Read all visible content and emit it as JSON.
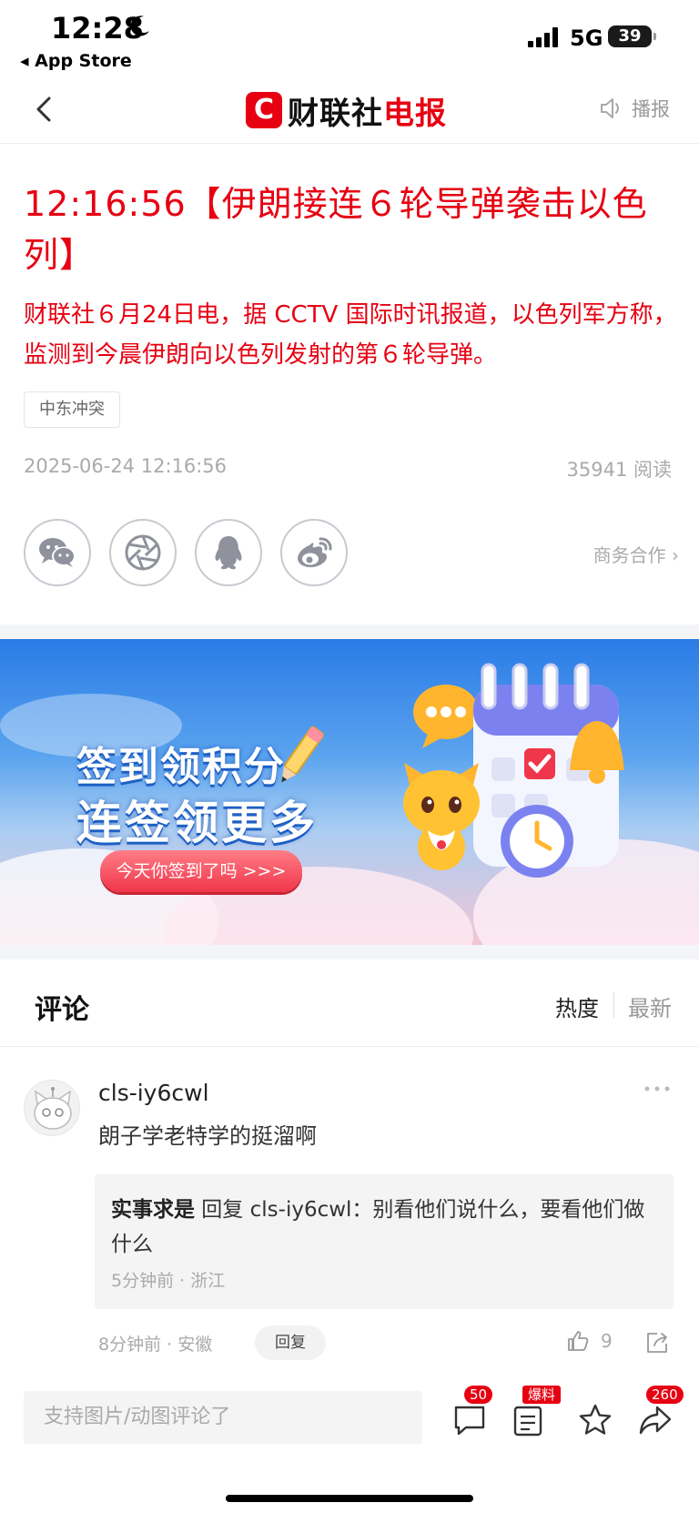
{
  "status_bar": {
    "time": "12:28",
    "back_app": "◂ App Store",
    "network": "5G",
    "battery": "39"
  },
  "nav": {
    "brand_c": "C",
    "brand_black": "财联社",
    "brand_red": "电报",
    "broadcast_label": "播报"
  },
  "article": {
    "headline": "12:16:56【伊朗接连６轮导弹袭击以色列】",
    "summary": "财联社６月24日电，据 CCTV 国际时讯报道，以色列军方称，监测到今晨伊朗向以色列发射的第６轮导弹。",
    "tag": "中东冲突",
    "date": "2025-06-24 12:16:56",
    "reads": "35941 阅读",
    "business": "商务合作 ›"
  },
  "share_icons": [
    "wechat-icon",
    "moments-icon",
    "qq-icon",
    "weibo-icon"
  ],
  "banner": {
    "title1": "签到领积分",
    "title2": "连签领更多",
    "button": "今天你签到了吗  >>>"
  },
  "comments": {
    "title": "评论",
    "sort_hot": "热度",
    "sort_new": "最新",
    "item": {
      "user": "cls-iy6cwl",
      "text": "朗子学老特学的挺溜啊",
      "reply_user": "实事求是",
      "reply_body": " 回复 cls-iy6cwl：别看他们说什么，要看他们做什么",
      "reply_meta": "5分钟前 · 浙江",
      "meta": "8分钟前 · 安徽",
      "reply_button": "回复",
      "likes": "9"
    }
  },
  "bottom_bar": {
    "placeholder": "支持图片/动图评论了",
    "comment_count": "50",
    "report_badge": "爆料",
    "share_count": "260"
  },
  "colors": {
    "brand_red": "#e60012",
    "muted": "#aaaaaa"
  }
}
